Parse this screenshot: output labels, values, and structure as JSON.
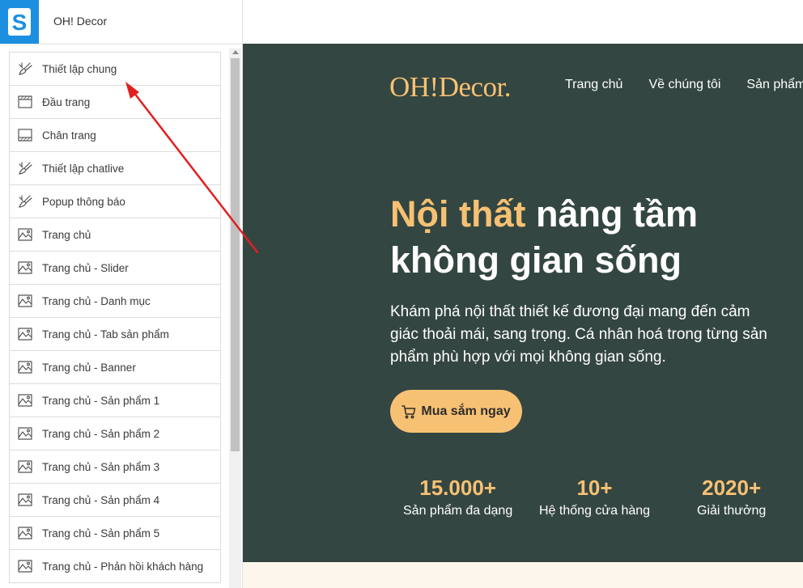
{
  "app": {
    "title": "OH! Decor",
    "logo_letter": "S",
    "accent": "#1d8fe0"
  },
  "sidebar": {
    "items": [
      {
        "label": "Thiết lập chung",
        "icon": "brush-icon"
      },
      {
        "label": "Đầu trang",
        "icon": "header-layout-icon"
      },
      {
        "label": "Chân trang",
        "icon": "footer-layout-icon"
      },
      {
        "label": "Thiết lập chatlive",
        "icon": "brush-icon"
      },
      {
        "label": "Popup thông báo",
        "icon": "brush-icon"
      },
      {
        "label": "Trang chủ",
        "icon": "image-icon"
      },
      {
        "label": "Trang chủ - Slider",
        "icon": "image-icon"
      },
      {
        "label": "Trang chủ - Danh mục",
        "icon": "image-icon"
      },
      {
        "label": "Trang chủ - Tab sản phẩm",
        "icon": "image-icon"
      },
      {
        "label": "Trang chủ - Banner",
        "icon": "image-icon"
      },
      {
        "label": "Trang chủ - Sản phẩm 1",
        "icon": "image-icon"
      },
      {
        "label": "Trang chủ - Sản phẩm 2",
        "icon": "image-icon"
      },
      {
        "label": "Trang chủ - Sản phẩm 3",
        "icon": "image-icon"
      },
      {
        "label": "Trang chủ - Sản phẩm 4",
        "icon": "image-icon"
      },
      {
        "label": "Trang chủ - Sản phẩm 5",
        "icon": "image-icon"
      },
      {
        "label": "Trang chủ - Phản hồi khách hàng",
        "icon": "image-icon"
      }
    ]
  },
  "preview": {
    "logo": "OH!Decor.",
    "nav": [
      "Trang chủ",
      "Về chúng tôi",
      "Sản phẩm"
    ],
    "hero": {
      "accent": "Nội thất",
      "line1_rest": " nâng tầm",
      "line2": "không gian sống"
    },
    "description": [
      "Khám phá nội thất thiết kế đương đại mang đến cảm",
      "giác thoải mái, sang trọng. Cá nhân hoá trong từng sản",
      "phẩm phù hợp với mọi không gian sống."
    ],
    "cta": "Mua sắm ngay",
    "stats": [
      {
        "value": "15.000+",
        "label": "Sản phẩm đa dạng"
      },
      {
        "value": "10+",
        "label": "Hệ thống cửa hàng"
      },
      {
        "value": "2020+",
        "label": "Giải thưởng"
      }
    ],
    "colors": {
      "background": "#344642",
      "accent": "#f7c173",
      "text": "#ffffff",
      "footer_strip": "#fdf6ec"
    }
  },
  "annotation": {
    "arrow_color": "#e02020"
  }
}
